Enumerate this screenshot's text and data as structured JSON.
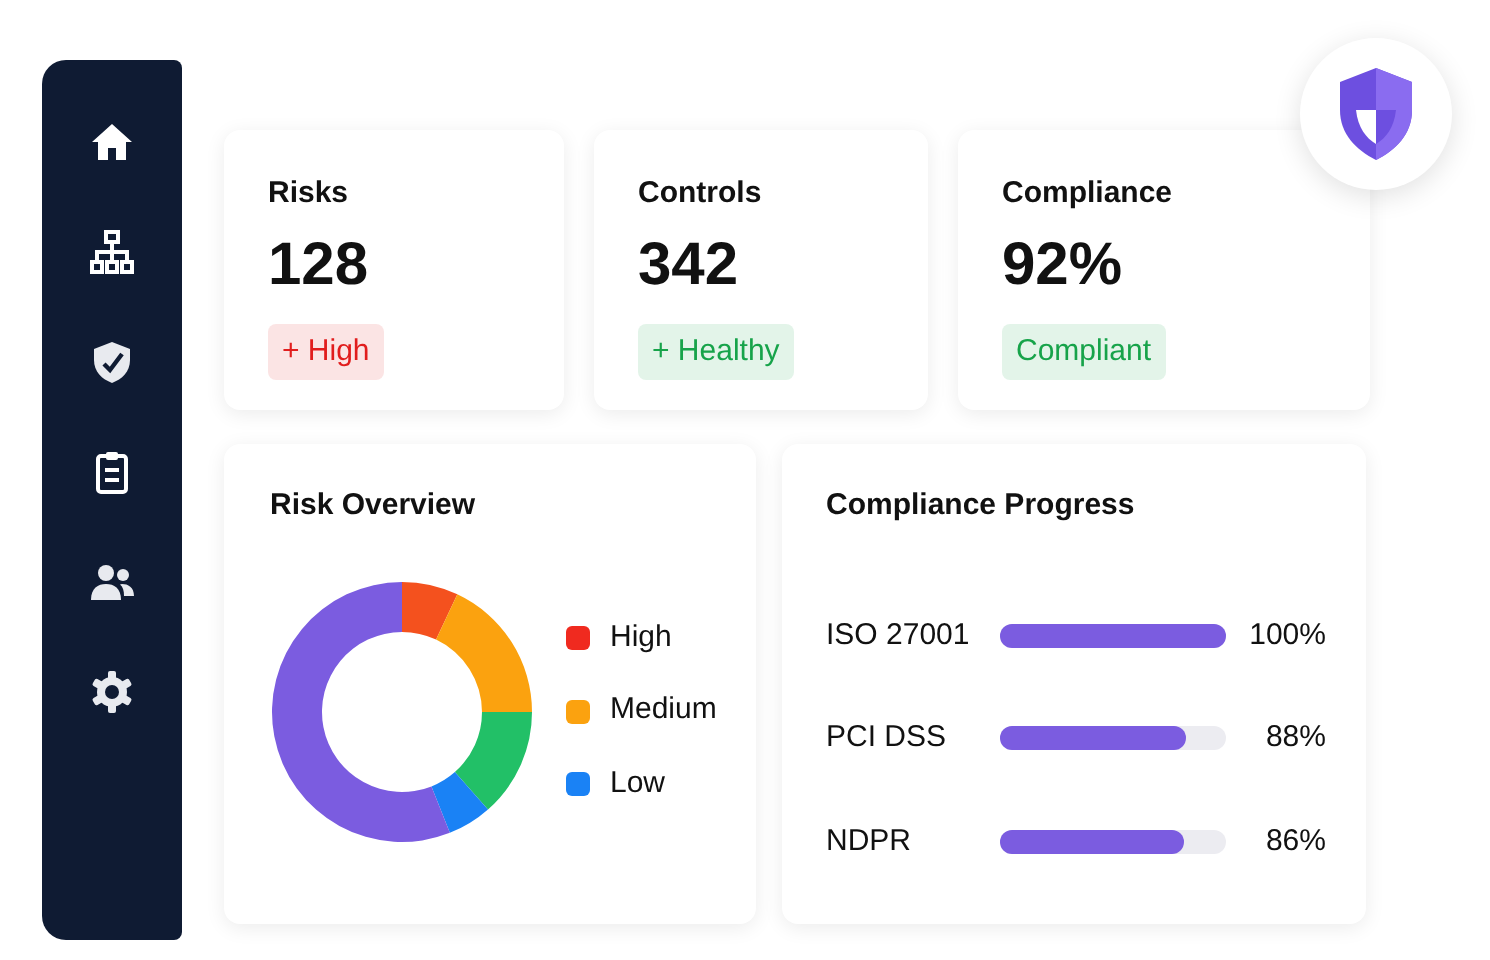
{
  "stats": [
    {
      "title": "Risks",
      "value": "128",
      "badge": "+ High",
      "color": "#e11d1d"
    },
    {
      "title": "Controls",
      "value": "342",
      "badge": "+ Healthy",
      "color": "#17a34a"
    },
    {
      "title": "Compliance",
      "value": "92%",
      "badge": "Compliant",
      "color": "#17a34a"
    }
  ],
  "risk_overview": {
    "title": "Risk Overview",
    "legend": [
      {
        "label": "High",
        "color": "#f02a1f"
      },
      {
        "label": "Medium",
        "color": "#fba20f"
      },
      {
        "label": "Low",
        "color": "#1a82f5"
      }
    ]
  },
  "compliance_progress": {
    "title": "Compliance Progress",
    "items": [
      {
        "name": "ISO 27001",
        "level": 1.0,
        "reading": "100%"
      },
      {
        "name": "PCI DSS",
        "level": 0.82,
        "reading": "88%"
      },
      {
        "name": "NDPR",
        "level": 0.81,
        "reading": "86%"
      }
    ]
  }
}
